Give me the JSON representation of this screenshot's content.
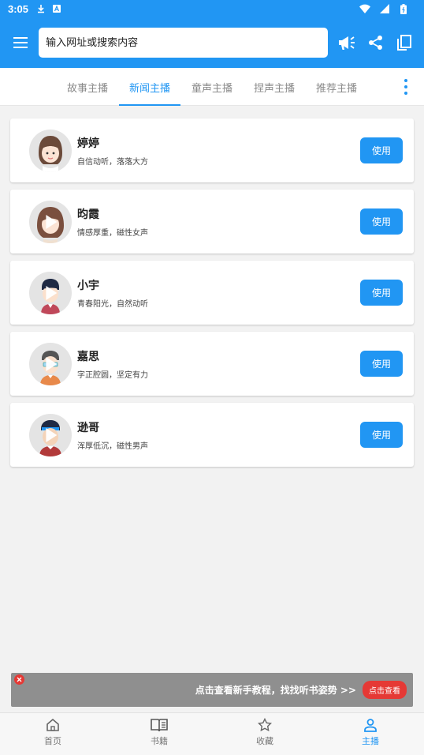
{
  "status_bar": {
    "time": "3:05"
  },
  "search": {
    "placeholder": "输入网址或搜索内容"
  },
  "tabs": [
    {
      "label": "故事主播",
      "active": false
    },
    {
      "label": "新闻主播",
      "active": true
    },
    {
      "label": "童声主播",
      "active": false
    },
    {
      "label": "捏声主播",
      "active": false
    },
    {
      "label": "推荐主播",
      "active": false
    }
  ],
  "anchors": [
    {
      "name": "婷婷",
      "desc": "自信动听，落落大方",
      "button": "使用",
      "has_play": false
    },
    {
      "name": "昀霞",
      "desc": "情感厚重，磁性女声",
      "button": "使用",
      "has_play": true
    },
    {
      "name": "小宇",
      "desc": "青春阳光，自然动听",
      "button": "使用",
      "has_play": true
    },
    {
      "name": "嘉思",
      "desc": "字正腔圆，坚定有力",
      "button": "使用",
      "has_play": true
    },
    {
      "name": "逊哥",
      "desc": "浑厚低沉，磁性男声",
      "button": "使用",
      "has_play": true
    }
  ],
  "banner": {
    "text": "点击查看新手教程，找找听书姿势 >>",
    "button": "点击查看"
  },
  "bottom_nav": [
    {
      "label": "首页",
      "icon": "home-icon",
      "active": false
    },
    {
      "label": "书籍",
      "icon": "book-icon",
      "active": false
    },
    {
      "label": "收藏",
      "icon": "star-icon",
      "active": false
    },
    {
      "label": "主播",
      "icon": "person-icon",
      "active": true
    }
  ],
  "colors": {
    "primary": "#2196f3",
    "banner_bg": "#8f8f8f",
    "banner_accent": "#e53935"
  }
}
